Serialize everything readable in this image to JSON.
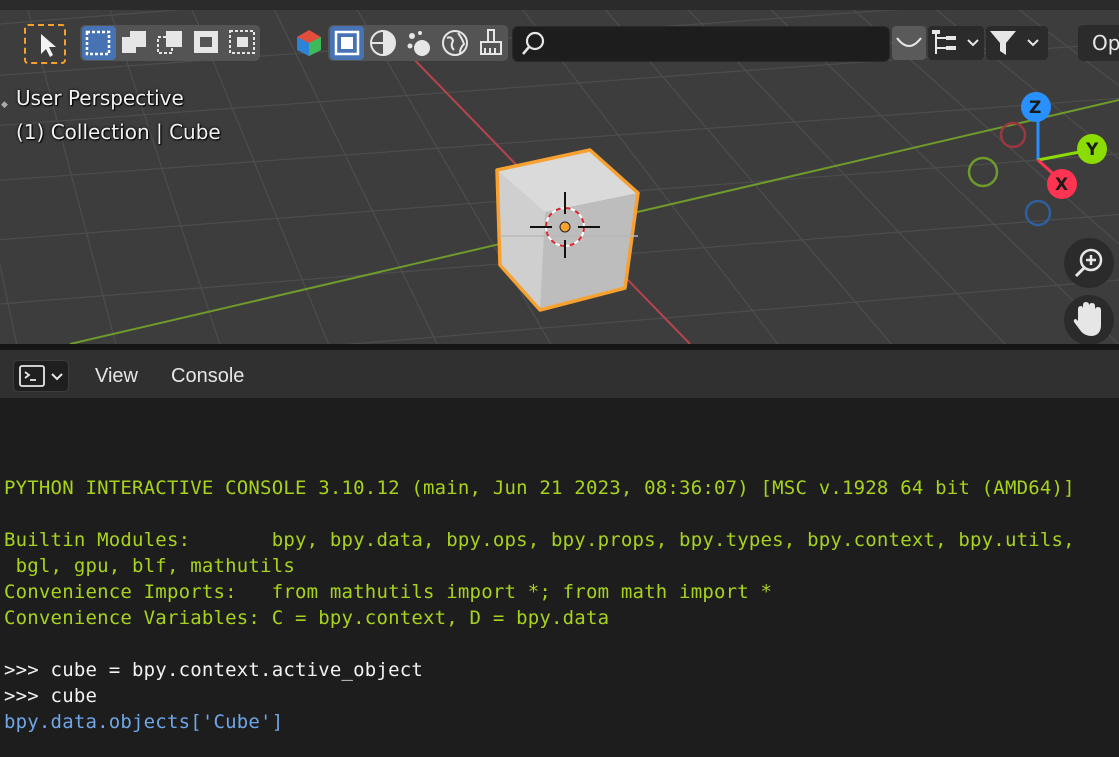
{
  "viewport": {
    "overlay": {
      "view_name": "User Perspective",
      "collection_info": "(1) Collection | Cube"
    },
    "gizmo": {
      "z": "Z",
      "y": "Y",
      "x": "X"
    },
    "search": {
      "placeholder": ""
    },
    "op_button": "Op",
    "colors": {
      "x_axis": "#ff3352",
      "y_axis": "#8bdc00",
      "z_axis": "#2890ff",
      "selection": "#f7a131"
    }
  },
  "console": {
    "menu": {
      "view": "View",
      "console": "Console"
    },
    "lines": {
      "l1": "PYTHON INTERACTIVE CONSOLE 3.10.12 (main, Jun 21 2023, 08:36:07) [MSC v.1928 64 bit (AMD64)]",
      "l2": "Builtin Modules:       bpy, bpy.data, bpy.ops, bpy.props, bpy.types, bpy.context, bpy.utils,",
      "l3": " bgl, gpu, blf, mathutils",
      "l4": "Convenience Imports:   from mathutils import *; from math import *",
      "l5": "Convenience Variables: C = bpy.context, D = bpy.data",
      "l6": ">>> cube = bpy.context.active_object",
      "l7": ">>> cube",
      "l8": "bpy.data.objects['Cube']"
    }
  }
}
